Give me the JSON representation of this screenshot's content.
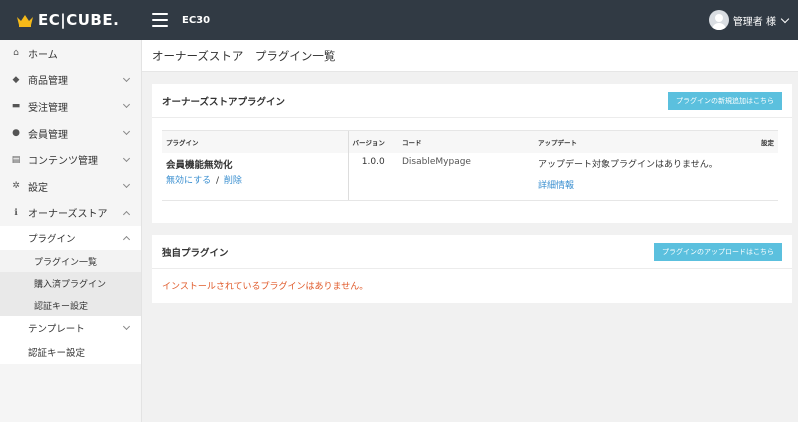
{
  "header": {
    "logo": "EC|CUBE.",
    "shop_name": "EC30",
    "user_name": "管理者 様"
  },
  "sidebar": {
    "items": [
      {
        "label": "ホーム",
        "icon": "home-icon"
      },
      {
        "label": "商品管理",
        "icon": "tag-icon"
      },
      {
        "label": "受注管理",
        "icon": "cart-icon"
      },
      {
        "label": "会員管理",
        "icon": "users-icon"
      },
      {
        "label": "コンテンツ管理",
        "icon": "file-icon"
      },
      {
        "label": "設定",
        "icon": "gear-icon"
      },
      {
        "label": "オーナーズストア",
        "icon": "info-icon"
      }
    ],
    "plugin_label": "プラグイン",
    "plugin_sub": [
      "プラグイン一覧",
      "購入済プラグイン",
      "認証キー設定"
    ],
    "template_label": "テンプレート",
    "other_label": "認証キー設定"
  },
  "page_title": "オーナーズストア　プラグイン一覧",
  "store_card": {
    "title": "オーナーズストアプラグイン",
    "button": "プラグインの新規追加はこちら",
    "columns": [
      "プラグイン",
      "バージョン",
      "コード",
      "アップデート",
      "設定"
    ],
    "rows": [
      {
        "name": "会員機能無効化",
        "action_disable": "無効にする",
        "action_sep": "/",
        "action_delete": "削除",
        "version": "1.0.0",
        "code": "DisableMypage",
        "update": "アップデート対象プラグインはありません。",
        "detail_link": "詳細情報"
      }
    ]
  },
  "own_card": {
    "title": "独自プラグイン",
    "button": "プラグインのアップロードはこちら",
    "notice": "インストールされているプラグインはありません。"
  }
}
